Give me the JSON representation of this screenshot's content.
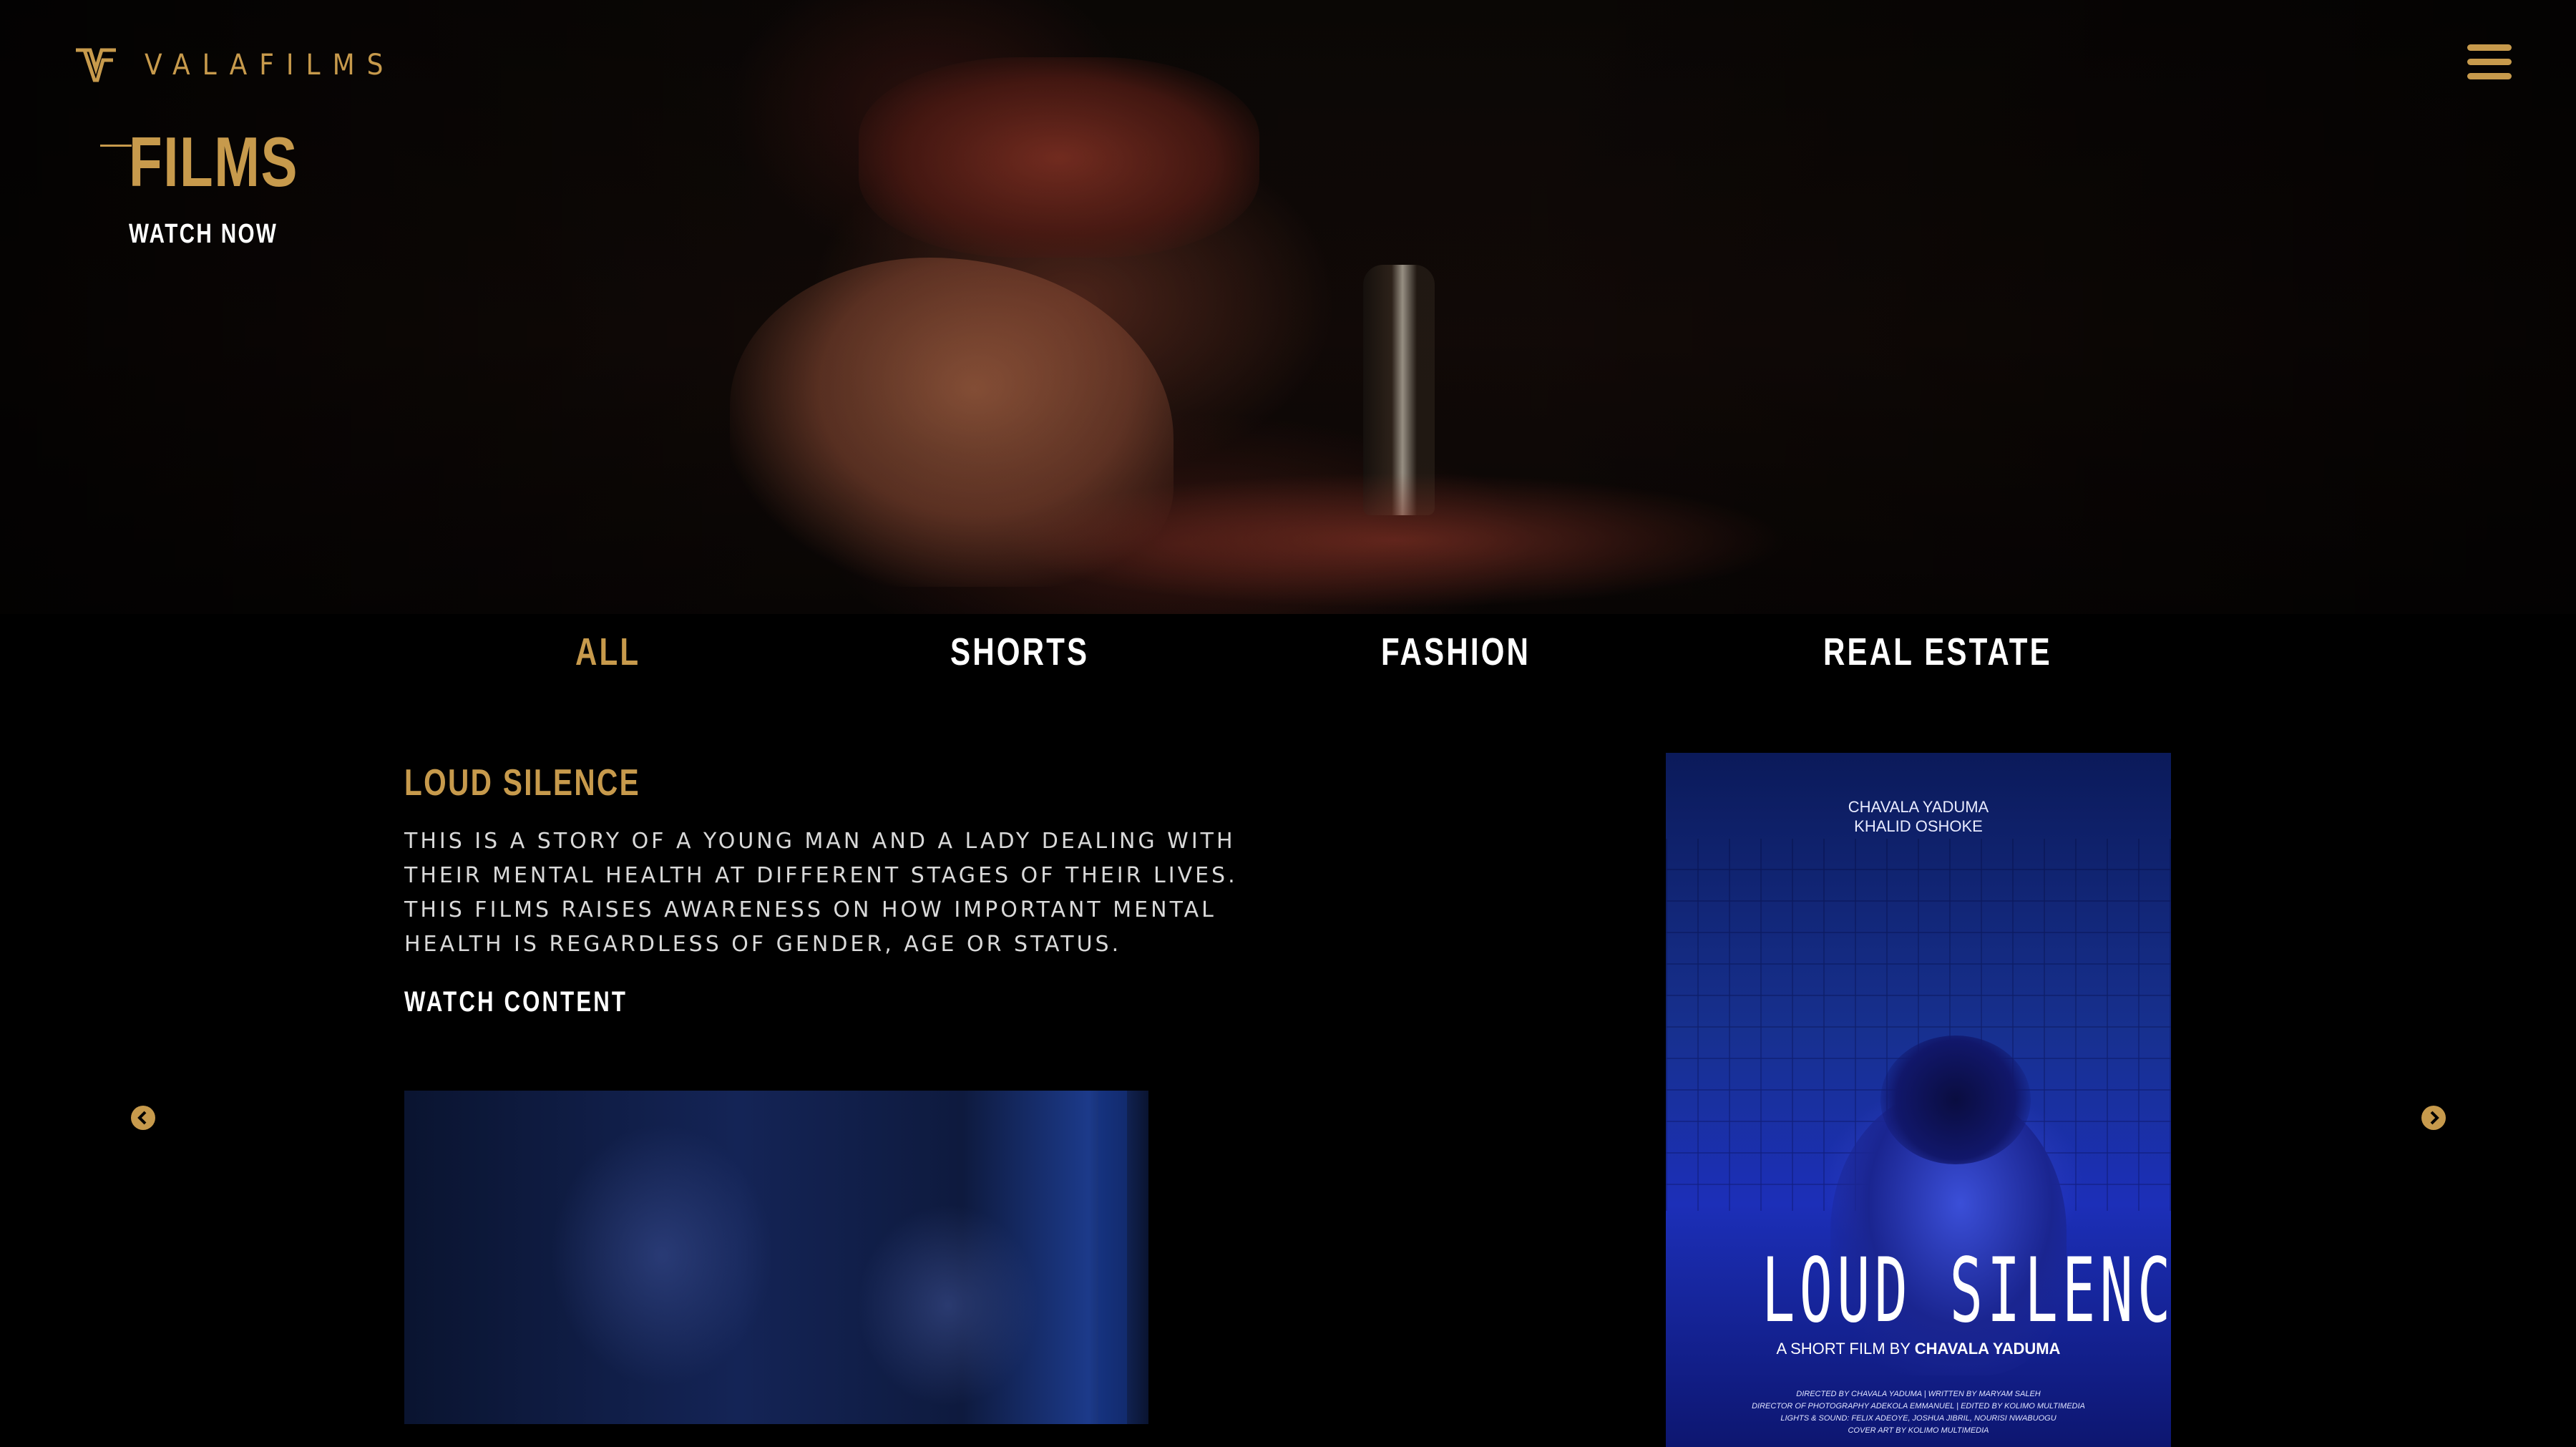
{
  "brand": {
    "name": "VALAFILMS",
    "accent_color": "#c79a4c"
  },
  "header": {
    "menu_icon": "hamburger-menu-icon"
  },
  "hero": {
    "title": "FILMS",
    "cta": "WATCH NOW"
  },
  "tabs": [
    {
      "label": "ALL",
      "active": true
    },
    {
      "label": "SHORTS",
      "active": false
    },
    {
      "label": "FASHION",
      "active": false
    },
    {
      "label": "REAL ESTATE",
      "active": false
    }
  ],
  "film": {
    "title": "LOUD SILENCE",
    "description": "THIS IS A STORY OF A YOUNG MAN AND A LADY DEALING WITH THEIR MENTAL HEALTH AT DIFFERENT STAGES OF THEIR LIVES. THIS FILMS RAISES AWARENESS ON HOW IMPORTANT MENTAL HEALTH IS REGARDLESS OF GENDER, AGE OR STATUS.",
    "cta": "WATCH CONTENT"
  },
  "poster": {
    "cast_1": "CHAVALA YADUMA",
    "cast_2": "KHALID OSHOKE",
    "title": "LOUD SILENCE",
    "subtitle_prefix": "A SHORT FILM BY",
    "subtitle_name": "CHAVALA YADUMA",
    "credits": [
      "DIRECTED BY CHAVALA YADUMA | WRITTEN BY MARYAM SALEH",
      "DIRECTOR OF PHOTOGRAPHY ADEKOLA EMMANUEL | EDITED BY KOLIMO MULTIMEDIA",
      "LIGHTS & SOUND: FELIX ADEOYE, JOSHUA JIBRIL, NOURISI NWABUOGU",
      "COVER ART BY KOLIMO MULTIMEDIA"
    ]
  },
  "carousel": {
    "prev_icon": "chevron-left-circle-icon",
    "next_icon": "chevron-right-circle-icon"
  }
}
